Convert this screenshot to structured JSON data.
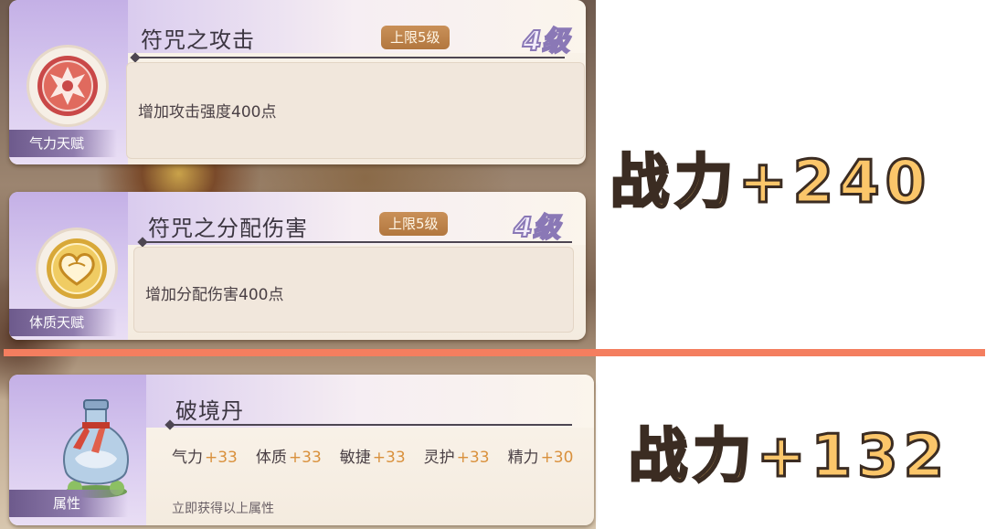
{
  "cards": [
    {
      "title": "符咒之攻击",
      "limit": "上限5级",
      "level": "4级",
      "tag": "气力天赋",
      "description": "增加攻击强度400点",
      "icon": "red-crest-icon"
    },
    {
      "title": "符咒之分配伤害",
      "limit": "上限5级",
      "level": "4级",
      "tag": "体质天赋",
      "description": "增加分配伤害400点",
      "icon": "gold-heart-icon"
    }
  ],
  "item": {
    "title": "破境丹",
    "tag": "属性",
    "icon": "potion-bottle-icon",
    "stats": [
      {
        "name": "气力",
        "value": "+33"
      },
      {
        "name": "体质",
        "value": "+33"
      },
      {
        "name": "敏捷",
        "value": "+33"
      },
      {
        "name": "灵护",
        "value": "+33"
      },
      {
        "name": "精力",
        "value": "+30"
      }
    ],
    "footnote": "立即获得以上属性"
  },
  "power_labels": {
    "talents": "战力+240",
    "item": "战力+132"
  },
  "colors": {
    "separator": "#f47e5f",
    "power_fill": "#fbc66a",
    "stat_value": "#d9913d",
    "level_stroke": "#8a78b6"
  }
}
